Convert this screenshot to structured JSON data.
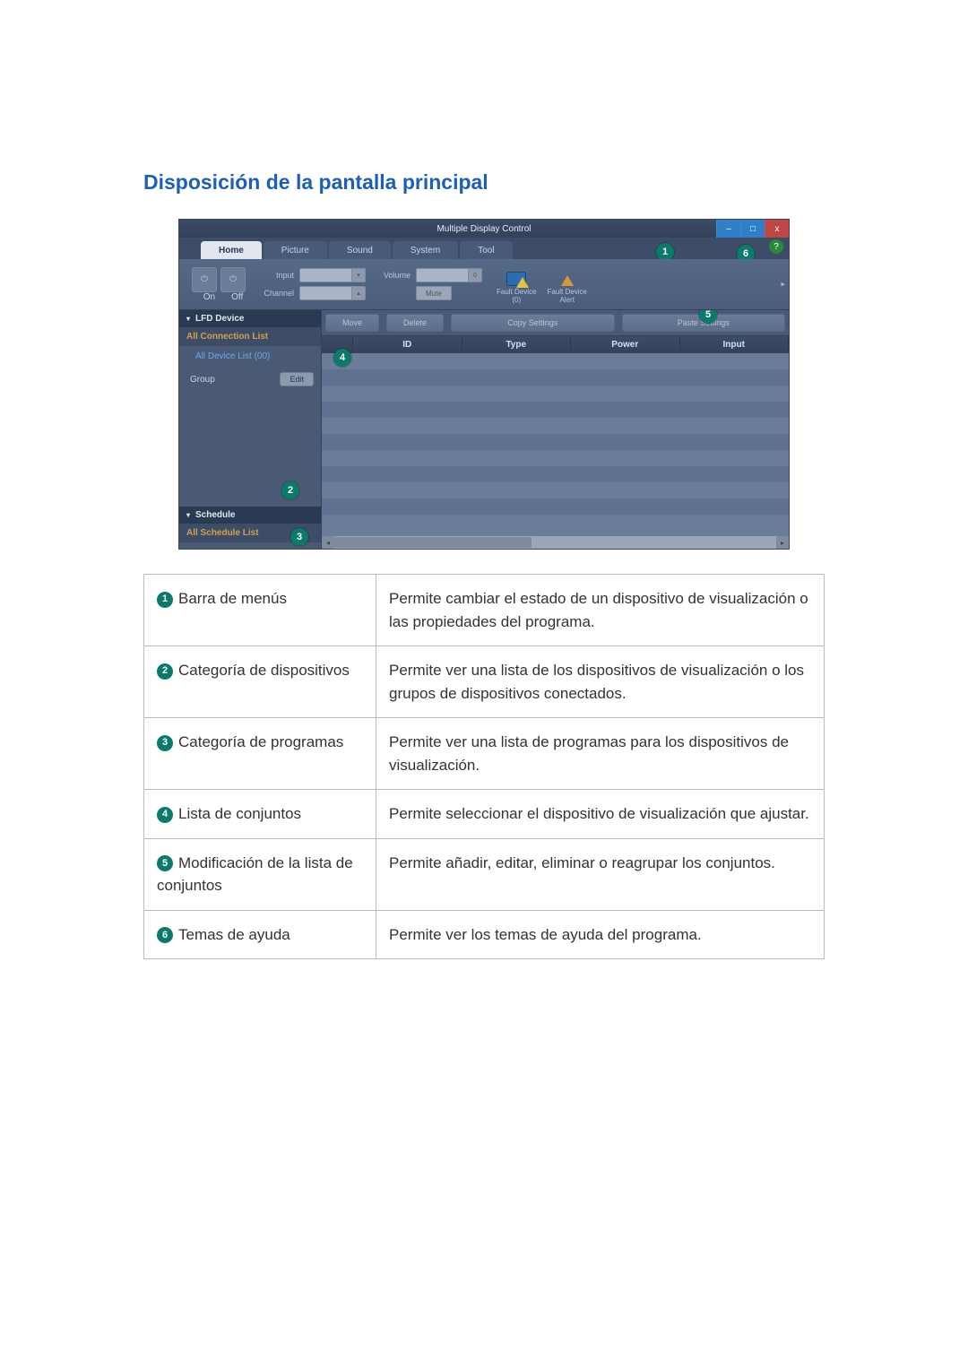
{
  "section_title": "Disposición de la pantalla principal",
  "app": {
    "window_title": "Multiple Display Control",
    "win_buttons": {
      "min": "–",
      "max": "□",
      "close": "x"
    },
    "tabs": {
      "home": "Home",
      "picture": "Picture",
      "sound": "Sound",
      "system": "System",
      "tool": "Tool"
    },
    "ribbon": {
      "power_on": "On",
      "power_off": "Off",
      "input_label": "Input",
      "channel_label": "Channel",
      "volume_label": "Volume",
      "mute_label": "Mute",
      "fault_device": "Fault Device\n(0)",
      "fault_alert": "Fault Device\nAlert"
    },
    "toolbar": {
      "move": "Move",
      "delete": "Delete",
      "copy": "Copy Settings",
      "paste": "Paste Settings"
    },
    "list_headers": {
      "blank": "",
      "id": "ID",
      "type": "Type",
      "power": "Power",
      "input": "Input"
    },
    "sidebar": {
      "lfd_device": "LFD Device",
      "all_connection": "All Connection List",
      "all_device_list": "All Device List (00)",
      "group": "Group",
      "edit": "Edit",
      "schedule": "Schedule",
      "all_schedule": "All Schedule List"
    }
  },
  "legend": [
    {
      "num": "1",
      "name": "Barra de menús",
      "desc": "Permite cambiar el estado de un dispositivo de visualización o las propiedades del programa."
    },
    {
      "num": "2",
      "name": "Categoría de dispositivos",
      "desc": "Permite ver una lista de los dispositivos de visualización o los grupos de dispositivos conectados."
    },
    {
      "num": "3",
      "name": "Categoría de programas",
      "desc": "Permite ver una lista de programas para los dispositivos de visualización."
    },
    {
      "num": "4",
      "name": "Lista de conjuntos",
      "desc": "Permite seleccionar el dispositivo de visualización que ajustar."
    },
    {
      "num": "5",
      "name": "Modificación de la lista de conjuntos",
      "desc": "Permite añadir, editar, eliminar o reagrupar los conjuntos."
    },
    {
      "num": "6",
      "name": "Temas de ayuda",
      "desc": "Permite ver los temas de ayuda del programa."
    }
  ]
}
